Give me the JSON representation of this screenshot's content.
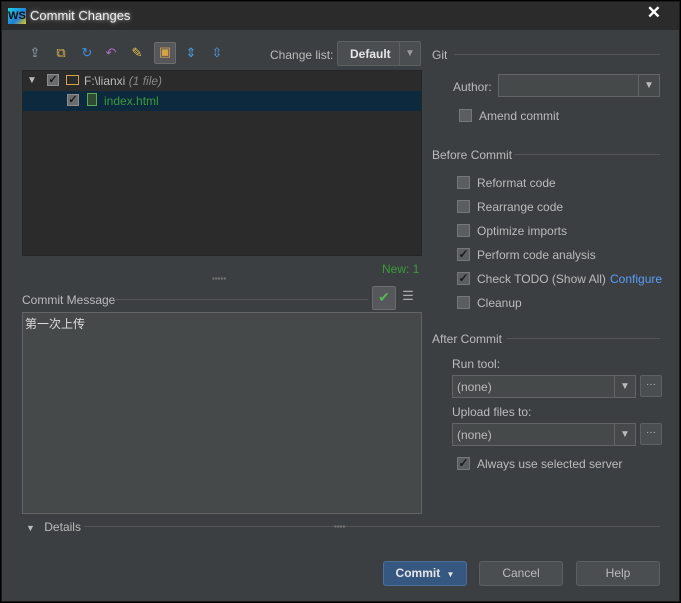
{
  "window": {
    "title": "Commit Changes",
    "logo_text": "WS",
    "close": "✕"
  },
  "toolbar": {
    "changelist_label": "Change list:",
    "changelist_value": "Default",
    "icons": [
      "move-to-changelist-icon",
      "refresh-icon",
      "rollback-icon",
      "revert-icon",
      "edit-source-icon",
      "group-by-directory-icon",
      "expand-all-icon",
      "collapse-all-icon"
    ]
  },
  "tree": {
    "root_path": "F:\\lianxi",
    "root_count": "(1 file)",
    "file_name": "index.html",
    "footer": "New: 1"
  },
  "commit_message": {
    "label": "Commit Message",
    "text": "第一次上传"
  },
  "details": {
    "label": "Details"
  },
  "git": {
    "section_title": "Git",
    "author_label": "Author:",
    "author_value": "",
    "amend_label": "Amend commit",
    "amend_checked": false
  },
  "before_commit": {
    "section_title": "Before Commit",
    "options": [
      {
        "label": "Reformat code",
        "checked": false
      },
      {
        "label": "Rearrange code",
        "checked": false
      },
      {
        "label": "Optimize imports",
        "checked": false
      },
      {
        "label": "Perform code analysis",
        "checked": true
      },
      {
        "label": "Check TODO (Show All)",
        "checked": true
      },
      {
        "label": "Cleanup",
        "checked": false
      }
    ],
    "configure_link": "Configure"
  },
  "after_commit": {
    "section_title": "After Commit",
    "run_tool_label": "Run tool:",
    "run_tool_value": "(none)",
    "upload_label": "Upload files to:",
    "upload_value": "(none)",
    "always_use_label": "Always use selected server",
    "always_use_checked": true
  },
  "buttons": {
    "commit": "Commit",
    "cancel": "Cancel",
    "help": "Help"
  },
  "colors": {
    "background": "#3c3f41",
    "tree_background": "#2b2b2b",
    "selection": "#0d293e",
    "added_file": "#3a9c3a",
    "link": "#589df6",
    "primary_button": "#365880"
  }
}
